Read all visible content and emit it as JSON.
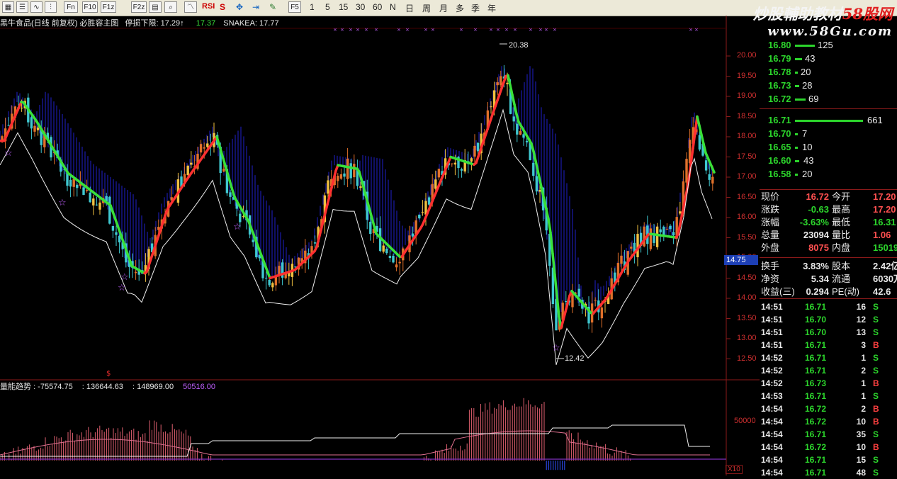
{
  "toolbar": {
    "buttons": [
      "Fn",
      "F10",
      "F1z",
      "F2z",
      "RSI",
      "S",
      "F5"
    ],
    "periods": [
      "1",
      "5",
      "15",
      "30",
      "60",
      "N"
    ],
    "ranges": [
      "日",
      "周",
      "月",
      "多",
      "季",
      "年"
    ]
  },
  "watermark": {
    "line1_a": "炒股輔助教材",
    "line1_b": "58股网",
    "line2": "www.58Gu.com"
  },
  "chart": {
    "title": "黑牛食品(日线 前复权) 必胜容主图",
    "stop_label": "停损下限: 17.29↑",
    "mid_label": "17.37",
    "snake_label": "SNAKEA: 17.77",
    "y_ticks": [
      "20.00",
      "19.50",
      "19.00",
      "18.50",
      "18.00",
      "17.50",
      "17.00",
      "16.50",
      "16.00",
      "15.50",
      "15.00",
      "14.50",
      "14.00",
      "13.50",
      "13.00",
      "12.50"
    ],
    "price_flag": "14.75",
    "high_label": "20.38",
    "low_label": "12.42",
    "colors": {
      "up": "#e0702a",
      "down": "#3fc8d0",
      "snake_up": "#ff3030",
      "snake_down": "#39e039",
      "cloud": "#1c1caa",
      "axis": "#8b1a1a"
    }
  },
  "volume": {
    "title": "量能趋势",
    "v1": ": -75574.75",
    "v2": ": 136644.63",
    "v3": ": 148969.00",
    "v4": "50516.00",
    "y_label": "50000",
    "unit": "X10"
  },
  "order_book": {
    "asks": [
      {
        "price": "16.80",
        "vol": "125"
      },
      {
        "price": "16.79",
        "vol": "43"
      },
      {
        "price": "16.78",
        "vol": "20"
      },
      {
        "price": "16.73",
        "vol": "28"
      },
      {
        "price": "16.72",
        "vol": "69"
      }
    ],
    "bids": [
      {
        "price": "16.71",
        "vol": "661"
      },
      {
        "price": "16.70",
        "vol": "7"
      },
      {
        "price": "16.65",
        "vol": "10"
      },
      {
        "price": "16.60",
        "vol": "43"
      },
      {
        "price": "16.58",
        "vol": "20"
      }
    ],
    "ask_levels": [
      125,
      43,
      20,
      28,
      69
    ],
    "bid_levels": [
      661,
      7,
      10,
      43,
      20
    ]
  },
  "quote": [
    {
      "k1": "现价",
      "v1": "16.72",
      "k2": "今开",
      "v2": "17.20"
    },
    {
      "k1": "涨跌",
      "v1": "-0.63",
      "k2": "最高",
      "v2": "17.20"
    },
    {
      "k1": "涨幅",
      "v1": "-3.63%",
      "k2": "最低",
      "v2": "16.31"
    },
    {
      "k1": "总量",
      "v1": "23094",
      "k2": "量比",
      "v2": "1.06"
    },
    {
      "k1": "外盘",
      "v1": "8075",
      "k2": "内盘",
      "v2": "15019"
    },
    {
      "k1": "换手",
      "v1": "3.83%",
      "k2": "股本",
      "v2": "2.42亿"
    },
    {
      "k1": "净资",
      "v1": "5.34",
      "k2": "流通",
      "v2": "6030万"
    },
    {
      "k1": "收益(三)",
      "v1": "0.294",
      "k2": "PE(动)",
      "v2": "42.6"
    }
  ],
  "ticks": [
    {
      "time": "14:51",
      "price": "16.71",
      "vol": "16",
      "bs": "S"
    },
    {
      "time": "14:51",
      "price": "16.70",
      "vol": "12",
      "bs": "S"
    },
    {
      "time": "14:51",
      "price": "16.70",
      "vol": "13",
      "bs": "S"
    },
    {
      "time": "14:51",
      "price": "16.71",
      "vol": "3",
      "bs": "B"
    },
    {
      "time": "14:52",
      "price": "16.71",
      "vol": "1",
      "bs": "S"
    },
    {
      "time": "14:52",
      "price": "16.71",
      "vol": "2",
      "bs": "S"
    },
    {
      "time": "14:52",
      "price": "16.73",
      "vol": "1",
      "bs": "B"
    },
    {
      "time": "14:53",
      "price": "16.71",
      "vol": "1",
      "bs": "S"
    },
    {
      "time": "14:54",
      "price": "16.72",
      "vol": "2",
      "bs": "B"
    },
    {
      "time": "14:54",
      "price": "16.72",
      "vol": "10",
      "bs": "B"
    },
    {
      "time": "14:54",
      "price": "16.71",
      "vol": "35",
      "bs": "S"
    },
    {
      "time": "14:54",
      "price": "16.72",
      "vol": "10",
      "bs": "B"
    },
    {
      "time": "14:54",
      "price": "16.71",
      "vol": "15",
      "bs": "S"
    },
    {
      "time": "14:54",
      "price": "16.71",
      "vol": "48",
      "bs": "S"
    }
  ]
}
